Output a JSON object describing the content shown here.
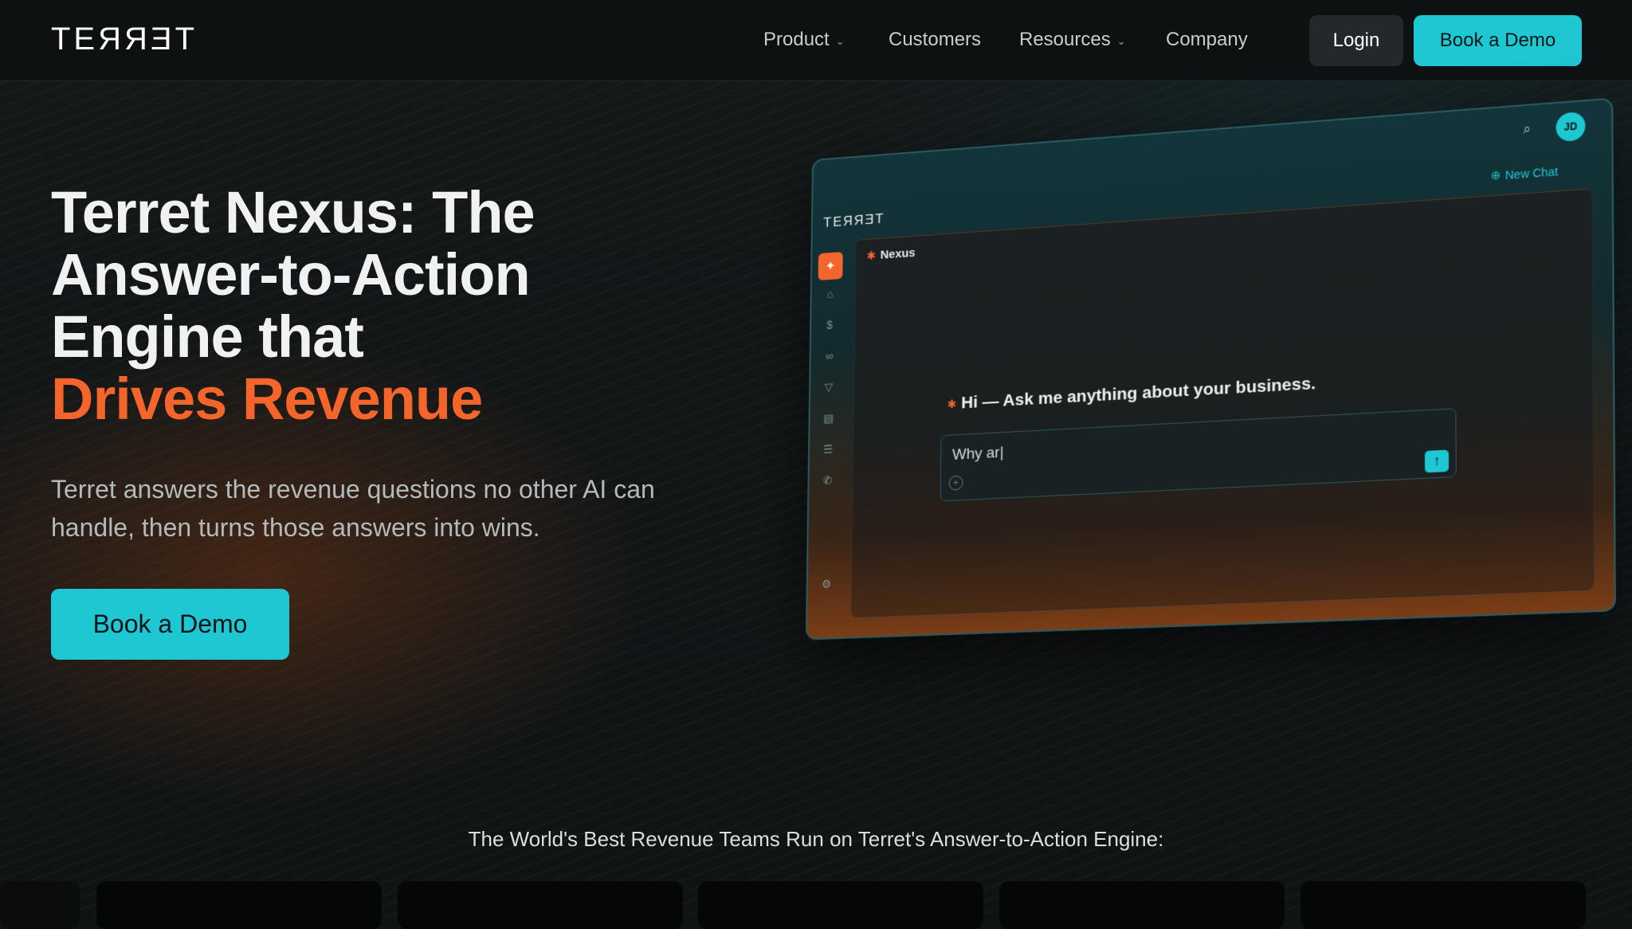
{
  "nav": {
    "logo": "TEЯЯƎT",
    "links": [
      {
        "label": "Product",
        "dropdown": true
      },
      {
        "label": "Customers",
        "dropdown": false
      },
      {
        "label": "Resources",
        "dropdown": true
      },
      {
        "label": "Company",
        "dropdown": false
      }
    ],
    "login_label": "Login",
    "demo_label": "Book a Demo"
  },
  "hero": {
    "title_line1": "Terret Nexus: The",
    "title_line2": "Answer-to-Action",
    "title_line3": "Engine that",
    "title_accent": "Drives Revenue",
    "subtitle": "Terret answers the revenue questions no other AI can handle, then turns those answers into wins.",
    "cta_label": "Book a Demo"
  },
  "mockup": {
    "logo": "TEЯЯƎT",
    "avatar": "JD",
    "new_chat": "New Chat",
    "tab_label": "Nexus",
    "greeting": "Hi — Ask me anything about your business.",
    "input_value": "Why ar|",
    "sidebar_icons": [
      "sparkle-icon",
      "home-icon",
      "dollar-icon",
      "binoculars-icon",
      "filter-icon",
      "document-icon",
      "list-icon",
      "phone-icon"
    ]
  },
  "logos": {
    "heading": "The World's Best Revenue Teams Run on Terret's Answer-to-Action Engine:"
  },
  "colors": {
    "accent_cyan": "#1ec8d3",
    "accent_orange": "#f4652b",
    "background": "#101314"
  }
}
